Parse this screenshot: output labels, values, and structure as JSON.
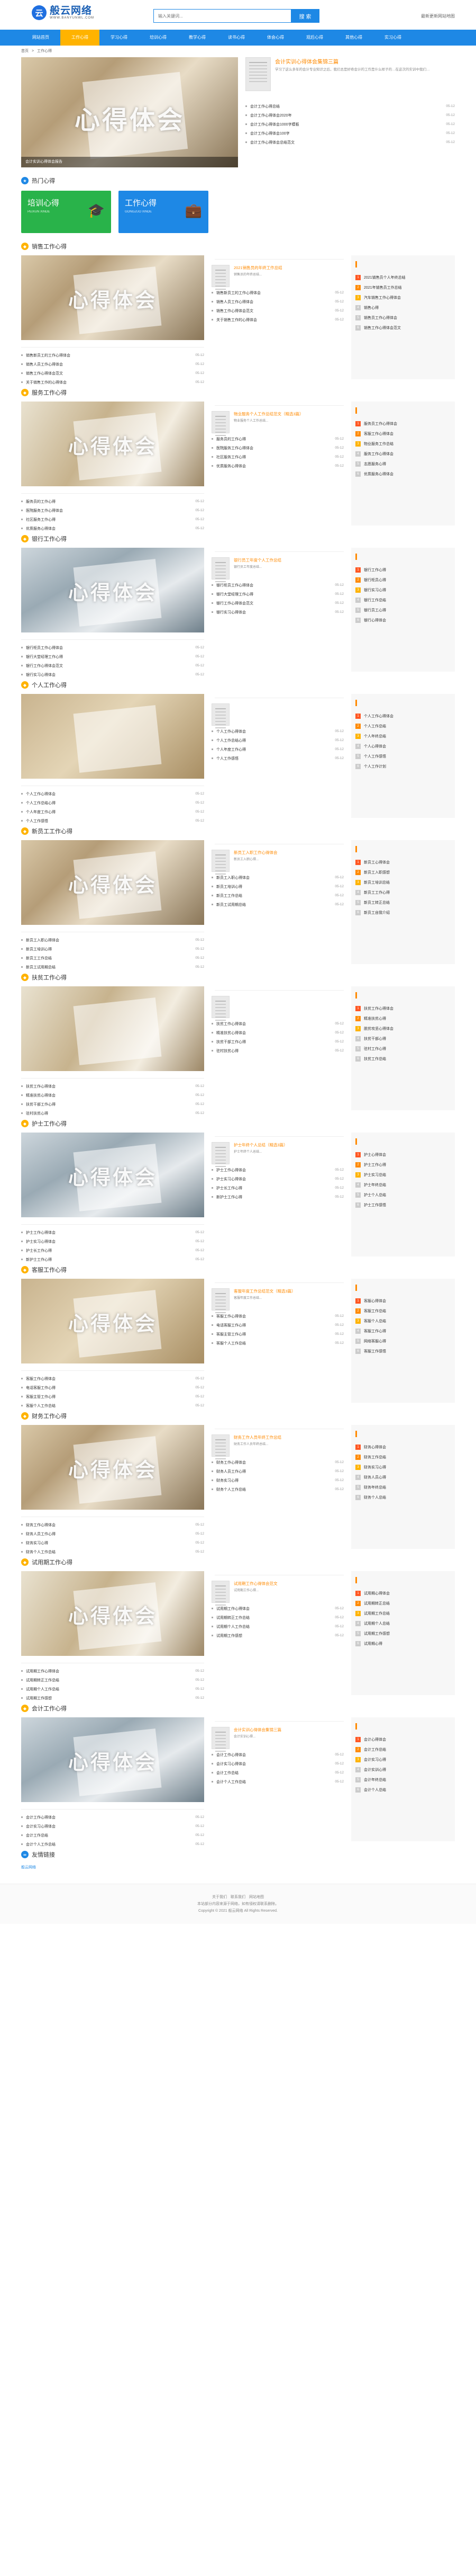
{
  "site": {
    "logo_char": "云",
    "name": "般云网络",
    "tagline": "WWW.BANYUNWL.COM",
    "search_placeholder": "输入关键词...",
    "search_button": "搜 索",
    "top_right": "最新更新网站地图"
  },
  "nav": [
    "网站首页",
    "工作心得",
    "学习心得",
    "培训心得",
    "教学心得",
    "读书心得",
    "体会心得",
    "观后心得",
    "其他心得",
    "实习心得"
  ],
  "breadcrumb": [
    "首页",
    ">",
    "工作心得"
  ],
  "hero": {
    "caption": "会计实训心得体会报告",
    "title_img": "心得体会",
    "feature_title": "会计实训心得体会集锦三篇",
    "feature_desc": "学习了这么多年的会计专业知识之后，我们总是好奇会计的工作是什么样子的…在这次的实训中我们…",
    "list": [
      {
        "t": "会计工作心得总结",
        "d": "05-12"
      },
      {
        "t": "会计工作心得体会2020年",
        "d": "05-12"
      },
      {
        "t": "会计工作心得体会1000字模板",
        "d": "05-12"
      },
      {
        "t": "会计工作心得体会100字",
        "d": "05-12"
      },
      {
        "t": "会计工作心得体会总结范文",
        "d": "05-12"
      }
    ]
  },
  "hot": {
    "title": "热门心得",
    "cards": [
      {
        "title": "培训心得",
        "sub": "PEIXUN XINDE",
        "icon": "🎓"
      },
      {
        "title": "工作心得",
        "sub": "GONGZUO XINDE",
        "icon": "💼"
      }
    ]
  },
  "sections": [
    {
      "title": "销售工作心得",
      "img": "心得体会",
      "feature_title": "2021销售员的年终工作总结",
      "feature_desc": "销售员的年终总结...",
      "list": [
        {
          "t": "销售新员工的工作心得体会",
          "d": "05-12"
        },
        {
          "t": "销售人员工作心得体会",
          "d": "05-12"
        },
        {
          "t": "销售工作心得体会范文",
          "d": "05-12"
        },
        {
          "t": "关于销售工作的心得体会",
          "d": "05-12"
        }
      ],
      "rank": [
        "2021销售员个人年终总结",
        "2021年销售员工作总结",
        "汽车销售工作心得体会",
        "销售心得",
        "销售员工作心得体会",
        "销售工作心得体会范文"
      ]
    },
    {
      "title": "服务工作心得",
      "img": "心得体会",
      "feature_title": "物业服务个人工作总结范文（精选3篇）",
      "feature_desc": "物业服务个人工作总结...",
      "list": [
        {
          "t": "服务员的工作心得",
          "d": "05-12"
        },
        {
          "t": "医院服务工作心得体会",
          "d": "05-12"
        },
        {
          "t": "社区服务工作心得",
          "d": "05-12"
        },
        {
          "t": "优质服务心得体会",
          "d": "05-12"
        }
      ],
      "rank": [
        "服务员工作心得体会",
        "客服工作心得体会",
        "物业服务工作总结",
        "服务工作心得体会",
        "志愿服务心得",
        "优质服务心得体会"
      ]
    },
    {
      "title": "银行工作心得",
      "img": "心得体会",
      "feature_title": "银行员工年度个人工作总结",
      "feature_desc": "银行员工年度总结...",
      "list": [
        {
          "t": "银行柜员工作心得体会",
          "d": "05-12"
        },
        {
          "t": "银行大堂经理工作心得",
          "d": "05-12"
        },
        {
          "t": "银行工作心得体会范文",
          "d": "05-12"
        },
        {
          "t": "银行实习心得体会",
          "d": "05-12"
        }
      ],
      "rank": [
        "银行工作心得",
        "银行柜员心得",
        "银行实习心得",
        "银行工作总结",
        "银行员工心得",
        "银行心得体会"
      ]
    },
    {
      "title": "个人工作心得",
      "img": "",
      "feature_title": "",
      "feature_desc": "",
      "list": [
        {
          "t": "个人工作心得体会",
          "d": "05-12"
        },
        {
          "t": "个人工作总结心得",
          "d": "05-12"
        },
        {
          "t": "个人年度工作心得",
          "d": "05-12"
        },
        {
          "t": "个人工作感悟",
          "d": "05-12"
        }
      ],
      "rank": [
        "个人工作心得体会",
        "个人工作总结",
        "个人年终总结",
        "个人心得体会",
        "个人工作感悟",
        "个人工作计划"
      ]
    },
    {
      "title": "新员工工作心得",
      "img": "心得体会",
      "feature_title": "新员工入职工作心得体会",
      "feature_desc": "新员工入职心得...",
      "list": [
        {
          "t": "新员工入职心得体会",
          "d": "05-12"
        },
        {
          "t": "新员工培训心得",
          "d": "05-12"
        },
        {
          "t": "新员工工作总结",
          "d": "05-12"
        },
        {
          "t": "新员工试用期总结",
          "d": "05-12"
        }
      ],
      "rank": [
        "新员工心得体会",
        "新员工入职感想",
        "新员工培训总结",
        "新员工工作心得",
        "新员工转正总结",
        "新员工自我介绍"
      ]
    },
    {
      "title": "扶贫工作心得",
      "img": "",
      "feature_title": "",
      "feature_desc": "",
      "list": [
        {
          "t": "扶贫工作心得体会",
          "d": "05-12"
        },
        {
          "t": "精准扶贫心得体会",
          "d": "05-12"
        },
        {
          "t": "扶贫干部工作心得",
          "d": "05-12"
        },
        {
          "t": "驻村扶贫心得",
          "d": "05-12"
        }
      ],
      "rank": [
        "扶贫工作心得体会",
        "精准扶贫心得",
        "脱贫攻坚心得体会",
        "扶贫干部心得",
        "驻村工作心得",
        "扶贫工作总结"
      ]
    },
    {
      "title": "护士工作心得",
      "img": "心得体会",
      "feature_title": "护士年终个人总结（精选3篇）",
      "feature_desc": "护士年终个人总结...",
      "list": [
        {
          "t": "护士工作心得体会",
          "d": "05-12"
        },
        {
          "t": "护士实习心得体会",
          "d": "05-12"
        },
        {
          "t": "护士长工作心得",
          "d": "05-12"
        },
        {
          "t": "新护士工作心得",
          "d": "05-12"
        }
      ],
      "rank": [
        "护士心得体会",
        "护士工作心得",
        "护士实习总结",
        "护士年终总结",
        "护士个人总结",
        "护士工作感悟"
      ]
    },
    {
      "title": "客服工作心得",
      "img": "心得体会",
      "feature_title": "客服年度工作总结范文（精选3篇）",
      "feature_desc": "客服年度工作总结...",
      "list": [
        {
          "t": "客服工作心得体会",
          "d": "05-12"
        },
        {
          "t": "电话客服工作心得",
          "d": "05-12"
        },
        {
          "t": "客服主管工作心得",
          "d": "05-12"
        },
        {
          "t": "客服个人工作总结",
          "d": "05-12"
        }
      ],
      "rank": [
        "客服心得体会",
        "客服工作总结",
        "客服个人总结",
        "客服工作心得",
        "网络客服心得",
        "客服工作感悟"
      ]
    },
    {
      "title": "财务工作心得",
      "img": "心得体会",
      "feature_title": "财务工作人员年终工作总结",
      "feature_desc": "财务工作人员年终总结...",
      "list": [
        {
          "t": "财务工作心得体会",
          "d": "05-12"
        },
        {
          "t": "财务人员工作心得",
          "d": "05-12"
        },
        {
          "t": "财务实习心得",
          "d": "05-12"
        },
        {
          "t": "财务个人工作总结",
          "d": "05-12"
        }
      ],
      "rank": [
        "财务心得体会",
        "财务工作总结",
        "财务实习心得",
        "财务人员心得",
        "财务年终总结",
        "财务个人总结"
      ]
    },
    {
      "title": "试用期工作心得",
      "img": "心得体会",
      "feature_title": "试用期工作心得体会范文",
      "feature_desc": "试用期工作心得...",
      "list": [
        {
          "t": "试用期工作心得体会",
          "d": "05-12"
        },
        {
          "t": "试用期转正工作总结",
          "d": "05-12"
        },
        {
          "t": "试用期个人工作总结",
          "d": "05-12"
        },
        {
          "t": "试用期工作感想",
          "d": "05-12"
        }
      ],
      "rank": [
        "试用期心得体会",
        "试用期转正总结",
        "试用期工作总结",
        "试用期个人总结",
        "试用期工作感想",
        "试用期心得"
      ]
    },
    {
      "title": "会计工作心得",
      "img": "心得体会",
      "feature_title": "会计实训心得体会集锦三篇",
      "feature_desc": "会计实训心得...",
      "list": [
        {
          "t": "会计工作心得体会",
          "d": "05-12"
        },
        {
          "t": "会计实习心得体会",
          "d": "05-12"
        },
        {
          "t": "会计工作总结",
          "d": "05-12"
        },
        {
          "t": "会计个人工作总结",
          "d": "05-12"
        }
      ],
      "rank": [
        "会计心得体会",
        "会计工作总结",
        "会计实习心得",
        "会计实训心得",
        "会计年终总结",
        "会计个人总结"
      ]
    }
  ],
  "links": {
    "title": "友情链接",
    "items": [
      "般云网络"
    ]
  },
  "footer": {
    "line1": "关于我们　联系我们　网站地图",
    "line2": "本站部分内容来源于网络，如有侵权请联系删除。",
    "line3": "Copyright © 2021 般云网络 All Rights Reserved."
  },
  "colors": {
    "primary": "#1e88e5",
    "accent": "#ffb300"
  }
}
